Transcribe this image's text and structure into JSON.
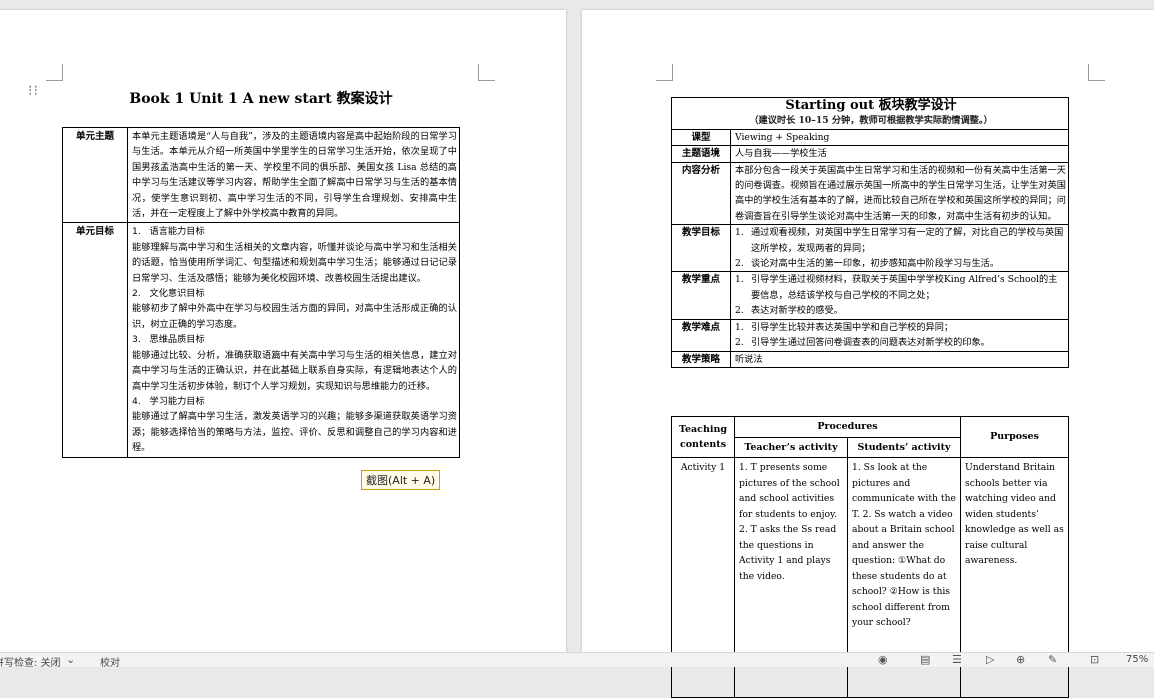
{
  "left_page": {
    "title": "Book 1 Unit 1 A new start 教案设计",
    "theme_label": "单元主题",
    "theme_text": "本单元主题语境是“人与自我”，涉及的主题语境内容是高中起始阶段的日常学习与生活。本单元从介绍一所英国中学里学生的日常学习生活开始，依次呈现了中国男孩孟浩高中生活的第一天、学校里不同的俱乐部、美国女孩 Lisa 总结的高中学习与生活建议等学习内容，帮助学生全面了解高中日常学习与生活的基本情况，使学生意识到初、高中学习生活的不同，引导学生合理规划、安排高中生活，并在一定程度上了解中外学校高中教育的异同。",
    "goals_label": "单元目标",
    "goals": [
      {
        "head": "1.   语言能力目标",
        "text": "能够理解与高中学习和生活相关的文章内容，听懂并谈论与高中学习和生活相关的话题，恰当使用所学词汇、句型描述和规划高中学习生活；能够通过日记记录日常学习、生活及感悟；能够为美化校园环境、改善校园生活提出建议。"
      },
      {
        "head": "2.   文化意识目标",
        "text": "能够初步了解中外高中在学习与校园生活方面的异同，对高中生活形成正确的认识，树立正确的学习态度。"
      },
      {
        "head": "3.   思维品质目标",
        "text": "能够通过比较、分析，准确获取语篇中有关高中学习与生活的相关信息，建立对高中学习与生活的正确认识，并在此基础上联系自身实际，有逻辑地表达个人的高中学习生活初步体验，制订个人学习规划，实现知识与思维能力的迁移。"
      },
      {
        "head": "4.   学习能力目标",
        "text": "能够通过了解高中学习生活，激发英语学习的兴趣；能够多渠道获取英语学习资源；能够选择恰当的策略与方法，监控、评价、反思和调整自己的学习内容和进程。"
      }
    ],
    "tooltip": "截图(Alt + A)"
  },
  "right_page": {
    "block_title": "Starting out 板块教学设计",
    "block_subtitle": "（建议时长 10–15 分钟，教师可根据教学实际酌情调整。）",
    "rows": [
      {
        "label": "课型",
        "text": "Viewing + Speaking"
      },
      {
        "label": "主题语境",
        "text": "人与自我——学校生活"
      },
      {
        "label": "内容分析",
        "text": "本部分包含一段关于英国高中生日常学习和生活的视频和一份有关高中生活第一天的问卷调查。视频旨在通过展示英国一所高中的学生日常学习生活，让学生对英国高中的学校生活有基本的了解，进而比较自己所在学校和英国这所学校的异同；问卷调查旨在引导学生谈论对高中生活第一天的印象，对高中生活有初步的认知。"
      }
    ],
    "objectives_label": "教学目标",
    "objectives": [
      {
        "n": "1.",
        "text": "通过观看视频，对英国中学生日常学习有一定的了解，对比自己的学校与英国这所学校，发现两者的异同；"
      },
      {
        "n": "2.",
        "text": "谈论对高中生活的第一印象，初步感知高中阶段学习与生活。"
      }
    ],
    "key_label": "教学重点",
    "key_points": [
      {
        "n": "1.",
        "text": "引导学生通过视频材料，获取关于英国中学学校King Alfred’s School的主要信息，总结该学校与自己学校的不同之处；"
      },
      {
        "n": "2.",
        "text": "表达对新学校的感受。"
      }
    ],
    "difficult_label": "教学难点",
    "difficult_points": [
      {
        "n": "1.",
        "text": "引导学生比较并表达英国中学和自己学校的异同；"
      },
      {
        "n": "2.",
        "text": "引导学生通过回答问卷调查表的问题表达对新学校的印象。"
      }
    ],
    "strategy_label": "教学策略",
    "strategy_text": "听说法",
    "procedures": {
      "h_contents": "Teaching contents",
      "h_procedures": "Procedures",
      "h_teacher": "Teacher’s activity",
      "h_students": "Students’ activity",
      "h_purposes": "Purposes",
      "activity": "Activity 1",
      "teacher_text": "1. T presents some pictures of the school and school activities for students to enjoy. 2. T asks the Ss read the questions in Activity 1 and plays the video.",
      "students_text": "1. Ss look at the pictures and communicate with the T. 2. Ss watch a video about a Britain school and answer the question: ①What do these students do at school? ②How is this school different from your school?",
      "purposes_text": "Understand Britain schools better via watching video and widen students’ knowledge as well as raise cultural awareness."
    }
  },
  "status_bar": {
    "spell_check": "拼写检查: 关闭",
    "proofread": "校对",
    "zoom": "75%"
  }
}
